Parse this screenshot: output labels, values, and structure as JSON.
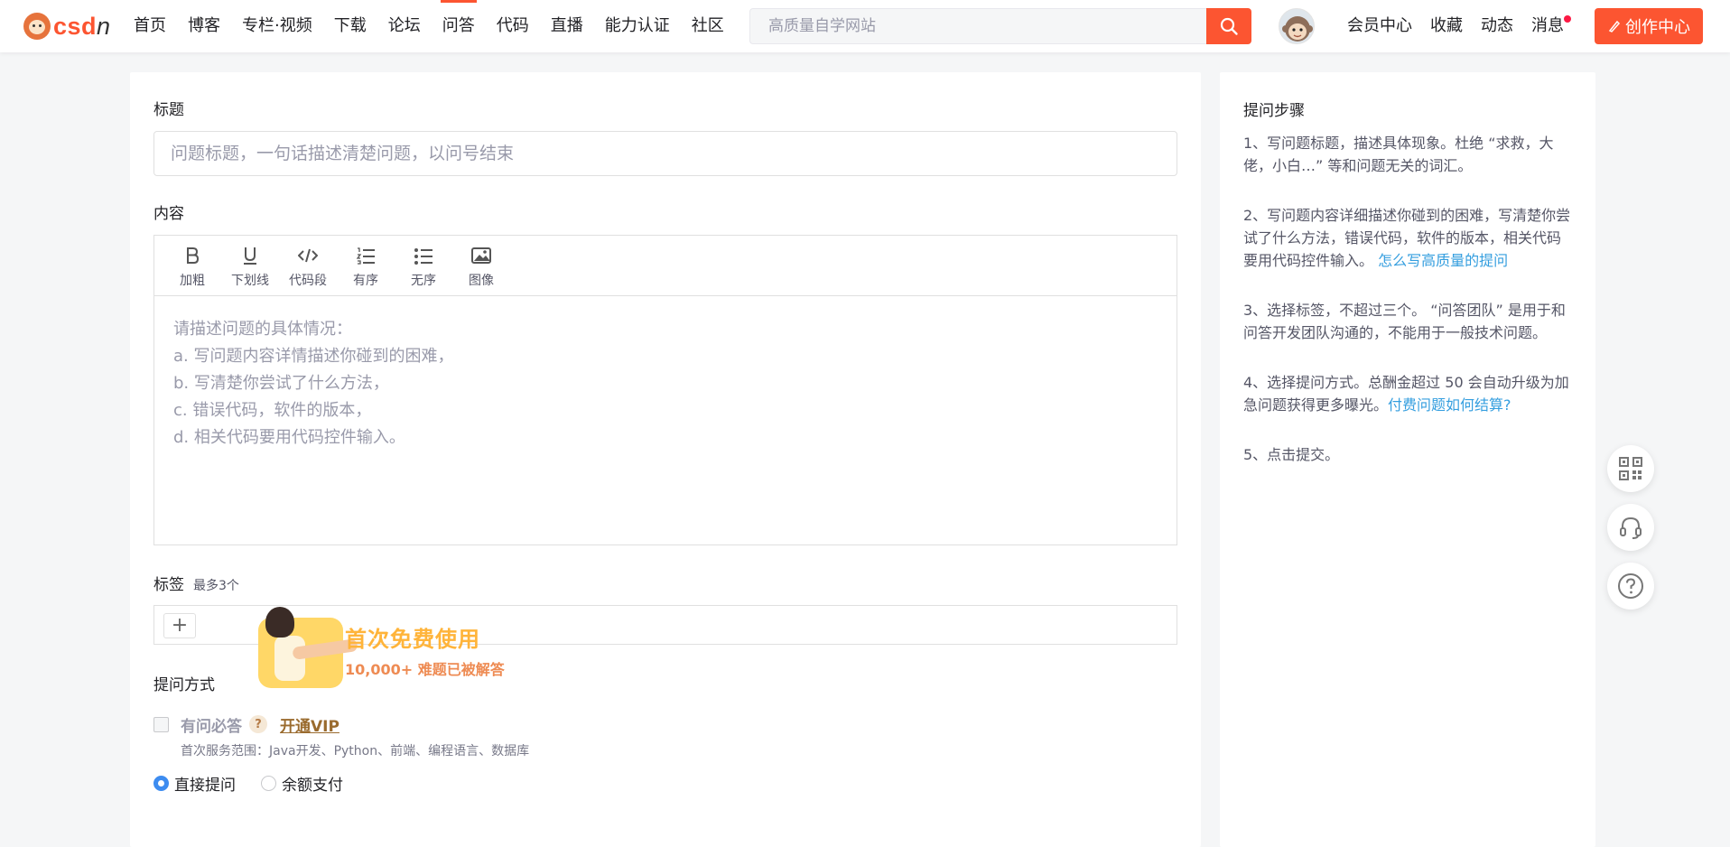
{
  "logo": {
    "brand_main": "csd",
    "brand_tail": "n"
  },
  "nav": {
    "items": [
      "首页",
      "博客",
      "专栏·视频",
      "下载",
      "论坛",
      "问答",
      "代码",
      "直播",
      "能力认证",
      "社区"
    ],
    "active_index": 5
  },
  "search": {
    "placeholder": "高质量自学网站"
  },
  "header_right": {
    "links": [
      "会员中心",
      "收藏",
      "动态",
      "消息"
    ],
    "create_label": "创作中心"
  },
  "form": {
    "title_label": "标题",
    "title_placeholder": "问题标题，一句话描述清楚问题，以问号结束",
    "content_label": "内容",
    "toolbar": [
      {
        "label": "加粗",
        "icon": "bold-icon"
      },
      {
        "label": "下划线",
        "icon": "underline-icon"
      },
      {
        "label": "代码段",
        "icon": "code-icon"
      },
      {
        "label": "有序",
        "icon": "ordered-list-icon"
      },
      {
        "label": "无序",
        "icon": "unordered-list-icon"
      },
      {
        "label": "图像",
        "icon": "image-icon"
      }
    ],
    "content_placeholder": "请描述问题的具体情况：\na. 写问题内容详情描述你碰到的困难，\nb. 写清楚你尝试了什么方法，\nc. 错误代码，软件的版本，\nd. 相关代码要用代码控件输入。",
    "tags_label": "标签",
    "tags_note": "最多3个",
    "tag_add": "+",
    "ask_mode_label": "提问方式",
    "vip_option": "有问必答",
    "vip_help": "?",
    "vip_link": "开通VIP",
    "vip_note": "首次服务范围：Java开发、Python、前端、编程语言、数据库",
    "radio_direct": "直接提问",
    "radio_balance": "余额支付"
  },
  "promo": {
    "title": "首次免费使用",
    "subtitle": "10,000+ 难题已被解答"
  },
  "steps": {
    "title": "提问步骤",
    "s1": "1、写问题标题，描述具体现象。杜绝 “求救，大佬，小白…” 等和问题无关的词汇。",
    "s2": "2、写问题内容详细描述你碰到的困难，写清楚你尝试了什么方法，错误代码，软件的版本，相关代码要用代码控件输入。",
    "s2_link": "怎么写高质量的提问",
    "s3": "3、选择标签，不超过三个。 “问答团队” 是用于和问答开发团队沟通的，不能用于一般技术问题。",
    "s4": "4、选择提问方式。总酬金超过 50 会自动升级为加急问题获得更多曝光。",
    "s4_link": "付费问题如何结算?",
    "s5": "5、点击提交。"
  },
  "colors": {
    "brand": "#fc5531",
    "link": "#349edf",
    "radio": "#3d8cf0"
  }
}
